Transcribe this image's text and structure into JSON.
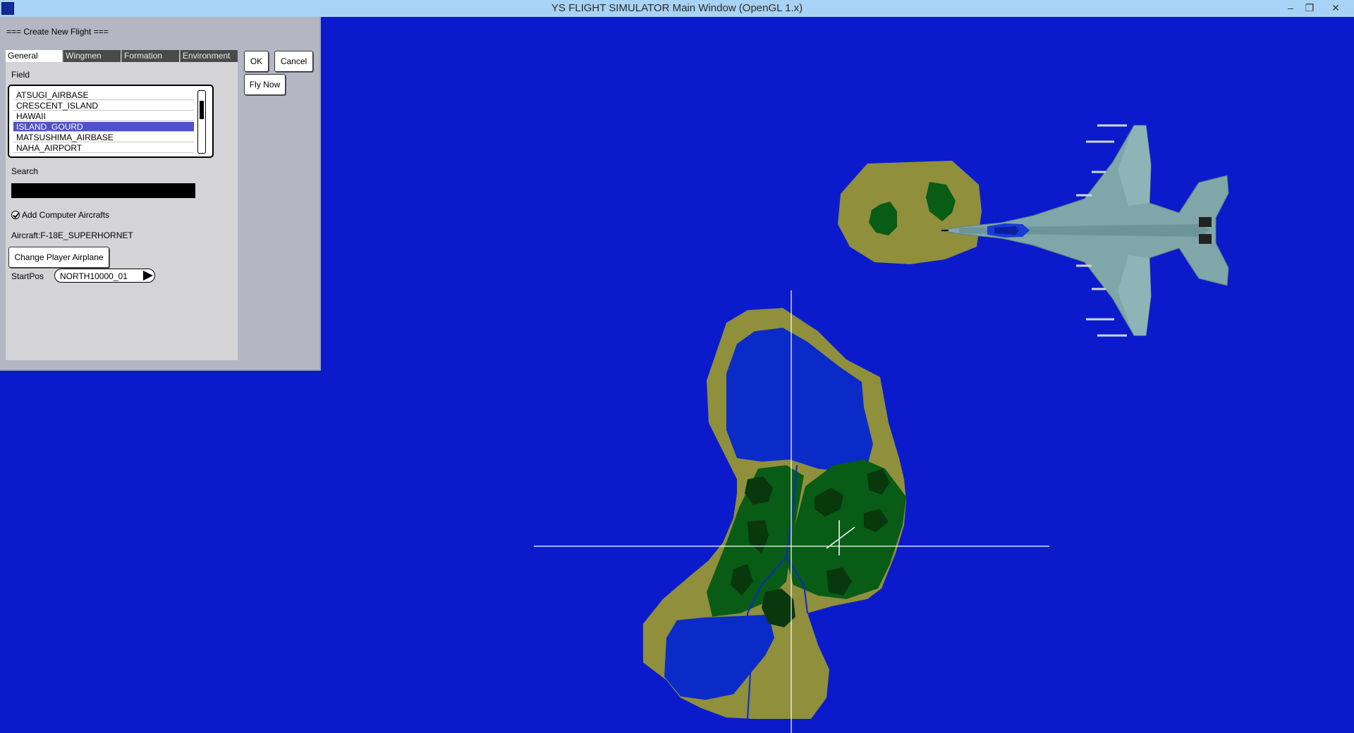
{
  "window": {
    "title": "YS FLIGHT SIMULATOR Main Window (OpenGL 1.x)",
    "minimize_glyph": "–",
    "restore_glyph": "❐",
    "close_glyph": "✕"
  },
  "dialog": {
    "title": "=== Create New Flight ===",
    "tabs": [
      "General",
      "Wingmen",
      "Formation",
      "Environment"
    ],
    "active_tab": "General",
    "field_label": "Field",
    "fields": [
      "ATSUGI_AIRBASE",
      "CRESCENT_ISLAND",
      "HAWAII",
      "ISLAND_GOURD",
      "MATSUSHIMA_AIRBASE",
      "NAHA_AIRPORT"
    ],
    "selected_field": "ISLAND_GOURD",
    "search_label": "Search",
    "search_value": "",
    "add_computer_label": "Add Computer Aircrafts",
    "aircraft_text": "Aircraft:F-18E_SUPERHORNET",
    "change_player_label": "Change Player Airplane",
    "startpos_label": "StartPos",
    "startpos_value": "NORTH10000_01",
    "ok_label": "OK",
    "cancel_label": "Cancel",
    "fly_now_label": "Fly Now"
  },
  "colors": {
    "sea": "#0b1bcc",
    "sand": "#8f8f3c",
    "forest": "#085c16",
    "dark_forest": "#08380c",
    "aircraft": "#7fa6a8"
  }
}
